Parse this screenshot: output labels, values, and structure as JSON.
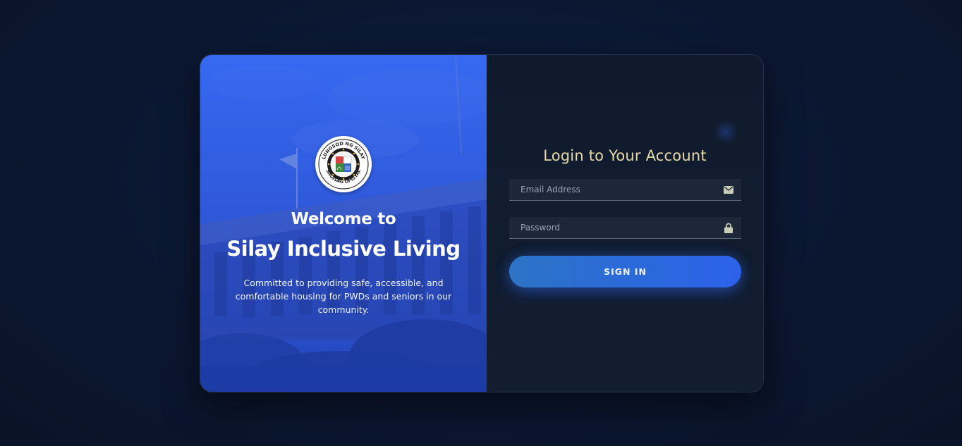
{
  "welcome": {
    "heading": "Welcome to",
    "app_name": "Silay Inclusive Living",
    "tagline": "Committed to providing safe, accessible, and comfortable housing for PWDs and seniors in our community."
  },
  "seal": {
    "top_text": "LUNGSOD NG SILAY",
    "bottom_text": "SAGISAG OPISYAL"
  },
  "login": {
    "title": "Login to Your Account",
    "email": {
      "placeholder": "Email Address",
      "value": "",
      "icon": "envelope-icon"
    },
    "password": {
      "placeholder": "Password",
      "value": "",
      "icon": "lock-icon"
    },
    "submit_label": "SIGN IN"
  },
  "colors": {
    "background": "#0b1731",
    "left_panel": "#2a4fd6",
    "right_panel": "#111c2f",
    "title_accent": "#e6d9a8",
    "button": "#2b6ad8"
  }
}
